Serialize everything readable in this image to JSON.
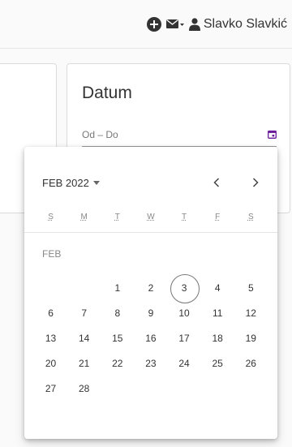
{
  "header": {
    "user_name": "Slavko Slavkić"
  },
  "filter_card": {
    "title": "Datum",
    "field_label": "Od – Do"
  },
  "calendar": {
    "month_year": "FEB 2022",
    "prev_label": "‹",
    "next_label": "›",
    "weekdays": [
      "S",
      "M",
      "T",
      "W",
      "T",
      "F",
      "S"
    ],
    "month_label": "FEB",
    "weeks": [
      [
        "",
        "",
        "1",
        "2",
        "3",
        "4",
        "5"
      ],
      [
        "6",
        "7",
        "8",
        "9",
        "10",
        "11",
        "12"
      ],
      [
        "13",
        "14",
        "15",
        "16",
        "17",
        "18",
        "19"
      ],
      [
        "20",
        "21",
        "22",
        "23",
        "24",
        "25",
        "26"
      ],
      [
        "27",
        "28",
        "",
        "",
        "",
        "",
        ""
      ]
    ],
    "today": "3"
  },
  "colors": {
    "accent": "#6a1b9a"
  }
}
